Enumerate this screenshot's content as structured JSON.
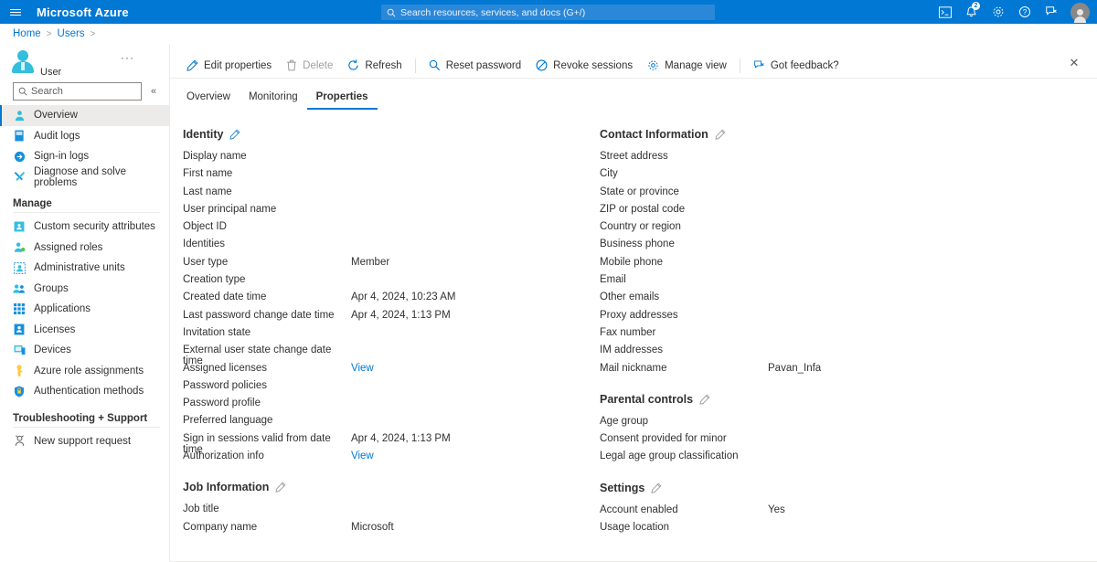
{
  "topbar": {
    "brand": "Microsoft Azure",
    "menu_icon": "hamburger-icon",
    "search_placeholder": "Search resources, services, and docs (G+/)",
    "icons": [
      {
        "name": "cloud-shell-icon",
        "label": ""
      },
      {
        "name": "notifications-bell-icon",
        "label": "",
        "badge": "2"
      },
      {
        "name": "settings-gear-icon",
        "label": ""
      },
      {
        "name": "help-question-icon",
        "label": ""
      },
      {
        "name": "feedback-icon",
        "label": ""
      }
    ]
  },
  "breadcrumb": {
    "items": [
      "Home",
      "Users",
      ""
    ],
    "separator": ">"
  },
  "blade": {
    "close_label": "✕",
    "resource_title": "User",
    "ellipsis": "···"
  },
  "sidebar": {
    "search_placeholder": "Search",
    "collapse_label": "«",
    "items": [
      {
        "label": "Overview",
        "icon": "user-overview-icon",
        "selected": true
      },
      {
        "label": "Audit logs",
        "icon": "audit-logs-icon",
        "selected": false
      },
      {
        "label": "Sign-in logs",
        "icon": "sign-in-logs-icon",
        "selected": false
      },
      {
        "label": "Diagnose and solve problems",
        "icon": "diagnose-wrench-icon",
        "selected": false
      }
    ],
    "groups": [
      {
        "title": "Manage",
        "items": [
          {
            "label": "Custom security attributes",
            "icon": "custom-security-attributes-icon"
          },
          {
            "label": "Assigned roles",
            "icon": "assigned-roles-icon"
          },
          {
            "label": "Administrative units",
            "icon": "administrative-units-icon"
          },
          {
            "label": "Groups",
            "icon": "groups-icon"
          },
          {
            "label": "Applications",
            "icon": "applications-icon"
          },
          {
            "label": "Licenses",
            "icon": "licenses-icon"
          },
          {
            "label": "Devices",
            "icon": "devices-icon"
          },
          {
            "label": "Azure role assignments",
            "icon": "azure-role-assignments-icon"
          },
          {
            "label": "Authentication methods",
            "icon": "authentication-methods-icon"
          }
        ]
      },
      {
        "title": "Troubleshooting + Support",
        "items": [
          {
            "label": "New support request",
            "icon": "new-support-request-icon"
          }
        ]
      }
    ]
  },
  "commandbar": {
    "items": [
      {
        "label": "Edit properties",
        "icon": "pencil-icon",
        "disabled": false
      },
      {
        "label": "Delete",
        "icon": "trash-icon",
        "disabled": true
      },
      {
        "label": "Refresh",
        "icon": "refresh-icon",
        "disabled": false
      },
      {
        "sep": true
      },
      {
        "label": "Reset password",
        "icon": "key-search-icon",
        "disabled": false
      },
      {
        "label": "Revoke sessions",
        "icon": "revoke-block-icon",
        "disabled": false
      },
      {
        "label": "Manage view",
        "icon": "gear-icon",
        "disabled": false
      },
      {
        "sep": true
      },
      {
        "label": "Got feedback?",
        "icon": "feedback-icon",
        "disabled": false
      }
    ]
  },
  "tabs": [
    {
      "label": "Overview",
      "active": false
    },
    {
      "label": "Monitoring",
      "active": false
    },
    {
      "label": "Properties",
      "active": true
    }
  ],
  "left_column": {
    "sections": [
      {
        "title": "Identity",
        "edit_icon": "pencil-icon",
        "edit_enabled": true,
        "rows": [
          {
            "key": "Display name",
            "value": ""
          },
          {
            "key": "First name",
            "value": ""
          },
          {
            "key": "Last name",
            "value": ""
          },
          {
            "key": "User principal name",
            "value": ""
          },
          {
            "key": "Object ID",
            "value": ""
          },
          {
            "key": "Identities",
            "value": ""
          },
          {
            "key": "User type",
            "value": "Member"
          },
          {
            "key": "Creation type",
            "value": ""
          },
          {
            "key": "Created date time",
            "value": "Apr 4, 2024, 10:23 AM"
          },
          {
            "key": "Last password change date time",
            "value": "Apr 4, 2024, 1:13 PM"
          },
          {
            "key": "Invitation state",
            "value": ""
          },
          {
            "key": "External user state change date time",
            "value": ""
          },
          {
            "key": "Assigned licenses",
            "value": "View",
            "link": true
          },
          {
            "key": "Password policies",
            "value": ""
          },
          {
            "key": "Password profile",
            "value": ""
          },
          {
            "key": "Preferred language",
            "value": ""
          },
          {
            "key": "Sign in sessions valid from date time",
            "value": "Apr 4, 2024, 1:13 PM"
          },
          {
            "key": "Authorization info",
            "value": "View",
            "link": true
          }
        ]
      },
      {
        "title": "Job Information",
        "edit_icon": "pencil-icon",
        "edit_enabled": false,
        "rows": [
          {
            "key": "Job title",
            "value": ""
          },
          {
            "key": "Company name",
            "value": "Microsoft"
          }
        ]
      }
    ]
  },
  "right_column": {
    "sections": [
      {
        "title": "Contact Information",
        "edit_icon": "pencil-icon",
        "edit_enabled": false,
        "rows": [
          {
            "key": "Street address",
            "value": ""
          },
          {
            "key": "City",
            "value": ""
          },
          {
            "key": "State or province",
            "value": ""
          },
          {
            "key": "ZIP or postal code",
            "value": ""
          },
          {
            "key": "Country or region",
            "value": ""
          },
          {
            "key": "Business phone",
            "value": ""
          },
          {
            "key": "Mobile phone",
            "value": ""
          },
          {
            "key": "Email",
            "value": ""
          },
          {
            "key": "Other emails",
            "value": ""
          },
          {
            "key": "Proxy addresses",
            "value": ""
          },
          {
            "key": "Fax number",
            "value": ""
          },
          {
            "key": "IM addresses",
            "value": ""
          },
          {
            "key": "Mail nickname",
            "value": "Pavan_Infa"
          }
        ]
      },
      {
        "title": "Parental controls",
        "edit_icon": "pencil-icon",
        "edit_enabled": false,
        "rows": [
          {
            "key": "Age group",
            "value": ""
          },
          {
            "key": "Consent provided for minor",
            "value": ""
          },
          {
            "key": "Legal age group classification",
            "value": ""
          }
        ]
      },
      {
        "title": "Settings",
        "edit_icon": "pencil-icon",
        "edit_enabled": false,
        "rows": [
          {
            "key": "Account enabled",
            "value": "Yes"
          },
          {
            "key": "Usage location",
            "value": ""
          }
        ]
      }
    ]
  },
  "colors": {
    "azure_blue": "#0078d4",
    "link_blue": "#0078d4",
    "nav_selected": "#edebe9",
    "text": "#323130",
    "disabled_text": "#a19f9d"
  }
}
